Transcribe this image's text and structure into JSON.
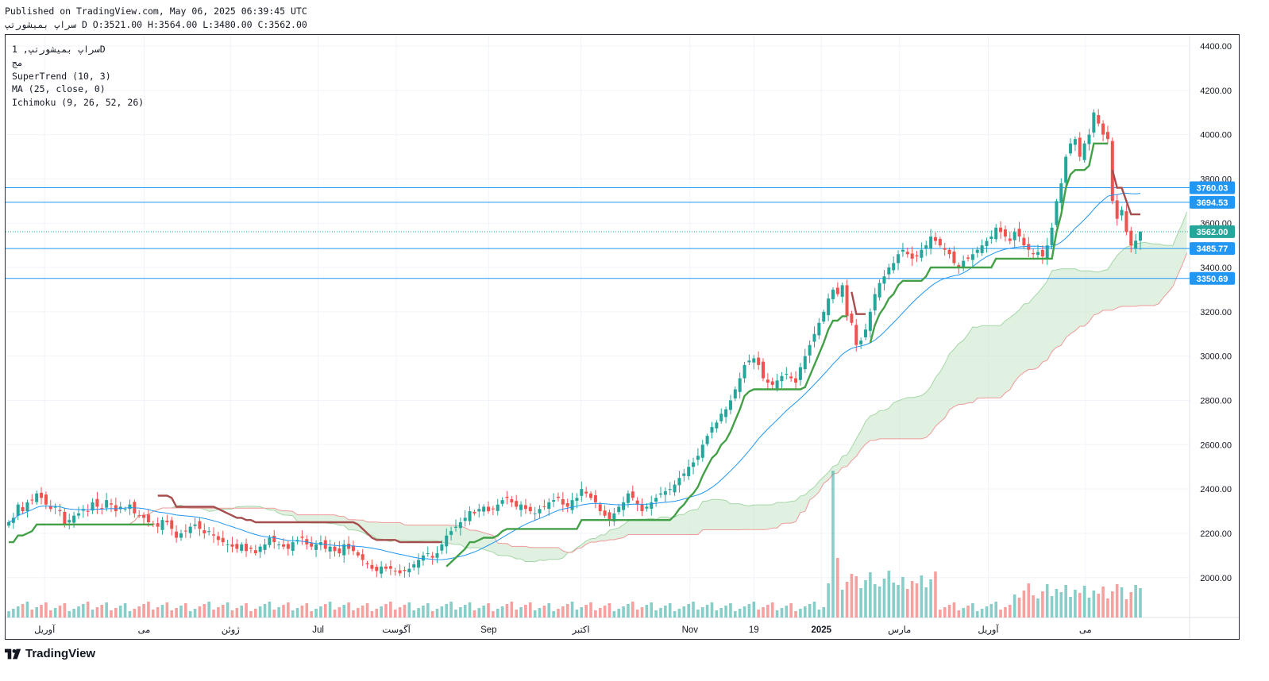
{
  "header": {
    "published": "Published on TradingView.com, May 06, 2025 06:39:45 UTC",
    "ohlc": "سراپ بمیشورتپ D O:3521.00 H:3564.00 L:3480.00 C:3562.00"
  },
  "legend": {
    "symbol": "سراپ بمیشورتپ, 1D",
    "exchange": "مج",
    "supertrend": "SuperTrend (10, 3)",
    "ma": "MA (25, close, 0)",
    "ichimoku": "Ichimoku (9, 26, 52, 26)"
  },
  "branding": {
    "logo_text": "TradingView"
  },
  "colors": {
    "up": "#26a69a",
    "down": "#ef5350",
    "supertrend_up": "#43a047",
    "supertrend_down": "#a64d4d",
    "ma": "#2196f3",
    "hline": "#2196f3",
    "last_price": "#26a69a",
    "cloud_bull": "#c8e6c9",
    "cloud_bear": "#f8d7d7"
  },
  "chart_data": {
    "type": "candlestick",
    "timeframe": "1D",
    "ylim": [
      1820,
      4450
    ],
    "y_ticks": [
      2000,
      2200,
      2400,
      2600,
      2800,
      3000,
      3200,
      3400,
      3600,
      3800,
      4000,
      4200,
      4400
    ],
    "x_labels": [
      {
        "label": "آوریل",
        "t": 0.033
      },
      {
        "label": "می",
        "t": 0.117
      },
      {
        "label": "ژوئن",
        "t": 0.19
      },
      {
        "label": "Jul",
        "t": 0.264
      },
      {
        "label": "آگوست",
        "t": 0.33
      },
      {
        "label": "Sep",
        "t": 0.408
      },
      {
        "label": "اکتبر",
        "t": 0.486
      },
      {
        "label": "Nov",
        "t": 0.578
      },
      {
        "label": "19",
        "t": 0.632
      },
      {
        "label": "2025",
        "t": 0.689
      },
      {
        "label": "مارس",
        "t": 0.755
      },
      {
        "label": "آوریل",
        "t": 0.83
      },
      {
        "label": "می",
        "t": 0.912
      }
    ],
    "horizontal_lines": [
      3760.03,
      3694.53,
      3485.77,
      3350.69
    ],
    "last_price": 3562.0,
    "last_ohlc": {
      "open": 3521.0,
      "high": 3564.0,
      "low": 3480.0,
      "close": 3562.0
    },
    "closes_daily_approx": [
      2250,
      2270,
      2330,
      2300,
      2340,
      2350,
      2380,
      2360,
      2330,
      2310,
      2320,
      2300,
      2240,
      2260,
      2280,
      2290,
      2310,
      2300,
      2340,
      2320,
      2310,
      2350,
      2330,
      2300,
      2320,
      2310,
      2330,
      2290,
      2280,
      2270,
      2250,
      2240,
      2230,
      2260,
      2250,
      2220,
      2180,
      2200,
      2210,
      2230,
      2240,
      2220,
      2200,
      2210,
      2190,
      2170,
      2160,
      2150,
      2140,
      2130,
      2150,
      2120,
      2130,
      2110,
      2140,
      2150,
      2180,
      2160,
      2150,
      2140,
      2130,
      2160,
      2170,
      2180,
      2150,
      2140,
      2150,
      2160,
      2130,
      2140,
      2120,
      2110,
      2150,
      2130,
      2120,
      2100,
      2080,
      2060,
      2040,
      2030,
      2050,
      2040,
      2040,
      2030,
      2020,
      2030,
      2040,
      2060,
      2080,
      2100,
      2110,
      2090,
      2110,
      2150,
      2190,
      2210,
      2230,
      2250,
      2270,
      2300,
      2290,
      2310,
      2320,
      2300,
      2310,
      2330,
      2350,
      2360,
      2340,
      2320,
      2330,
      2310,
      2300,
      2290,
      2310,
      2320,
      2340,
      2350,
      2360,
      2330,
      2320,
      2350,
      2360,
      2400,
      2380,
      2360,
      2340,
      2300,
      2280,
      2260,
      2290,
      2320,
      2340,
      2380,
      2360,
      2330,
      2300,
      2320,
      2340,
      2360,
      2380,
      2390,
      2400,
      2420,
      2450,
      2470,
      2500,
      2520,
      2550,
      2600,
      2640,
      2680,
      2700,
      2740,
      2760,
      2800,
      2850,
      2900,
      2960,
      2980,
      2990,
      2960,
      2900,
      2880,
      2870,
      2890,
      2910,
      2920,
      2900,
      2880,
      2950,
      3000,
      3050,
      3100,
      3150,
      3200,
      3260,
      3300,
      3280,
      3320,
      3180,
      3150,
      3050,
      3070,
      3120,
      3200,
      3280,
      3330,
      3360,
      3400,
      3420,
      3460,
      3480,
      3460,
      3440,
      3450,
      3480,
      3500,
      3540,
      3520,
      3500,
      3480,
      3460,
      3420,
      3400,
      3430,
      3440,
      3460,
      3480,
      3500,
      3520,
      3540,
      3580,
      3560,
      3540,
      3520,
      3560,
      3540,
      3500,
      3480,
      3460,
      3470,
      3450,
      3500,
      3580,
      3700,
      3780,
      3900,
      3960,
      3980,
      3900,
      3960,
      4000,
      4100,
      4050,
      4000,
      3980,
      3700,
      3620,
      3660,
      3560,
      3500,
      3521,
      3562
    ],
    "volume_note": "Volume histogram shown beneath price; peak volume bar near start of 2025"
  }
}
